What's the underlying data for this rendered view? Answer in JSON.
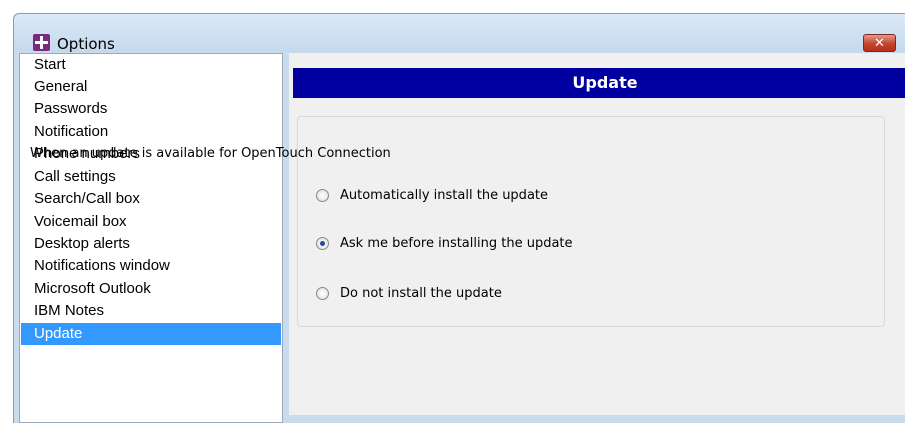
{
  "window": {
    "title": "Options",
    "close_label": "✕"
  },
  "sidebar": {
    "items": [
      {
        "label": "Start",
        "selected": false
      },
      {
        "label": "General",
        "selected": false
      },
      {
        "label": "Passwords",
        "selected": false
      },
      {
        "label": "Notification",
        "selected": false
      },
      {
        "label": "Phone numbers",
        "selected": false
      },
      {
        "label": "Call settings",
        "selected": false
      },
      {
        "label": "Search/Call box",
        "selected": false
      },
      {
        "label": "Voicemail box",
        "selected": false
      },
      {
        "label": "Desktop alerts",
        "selected": false
      },
      {
        "label": "Notifications window",
        "selected": false
      },
      {
        "label": "Microsoft Outlook",
        "selected": false
      },
      {
        "label": "IBM Notes",
        "selected": false
      },
      {
        "label": "Update",
        "selected": true
      }
    ]
  },
  "main": {
    "header": "Update",
    "prompt": "When an update is available for OpenTouch Connection",
    "options": [
      {
        "label": "Automatically install the update",
        "checked": false
      },
      {
        "label": "Ask me before installing the update",
        "checked": true
      },
      {
        "label": "Do not install the update",
        "checked": false
      }
    ]
  },
  "colors": {
    "header_bg": "#0000a0",
    "selection": "#3399ff"
  }
}
